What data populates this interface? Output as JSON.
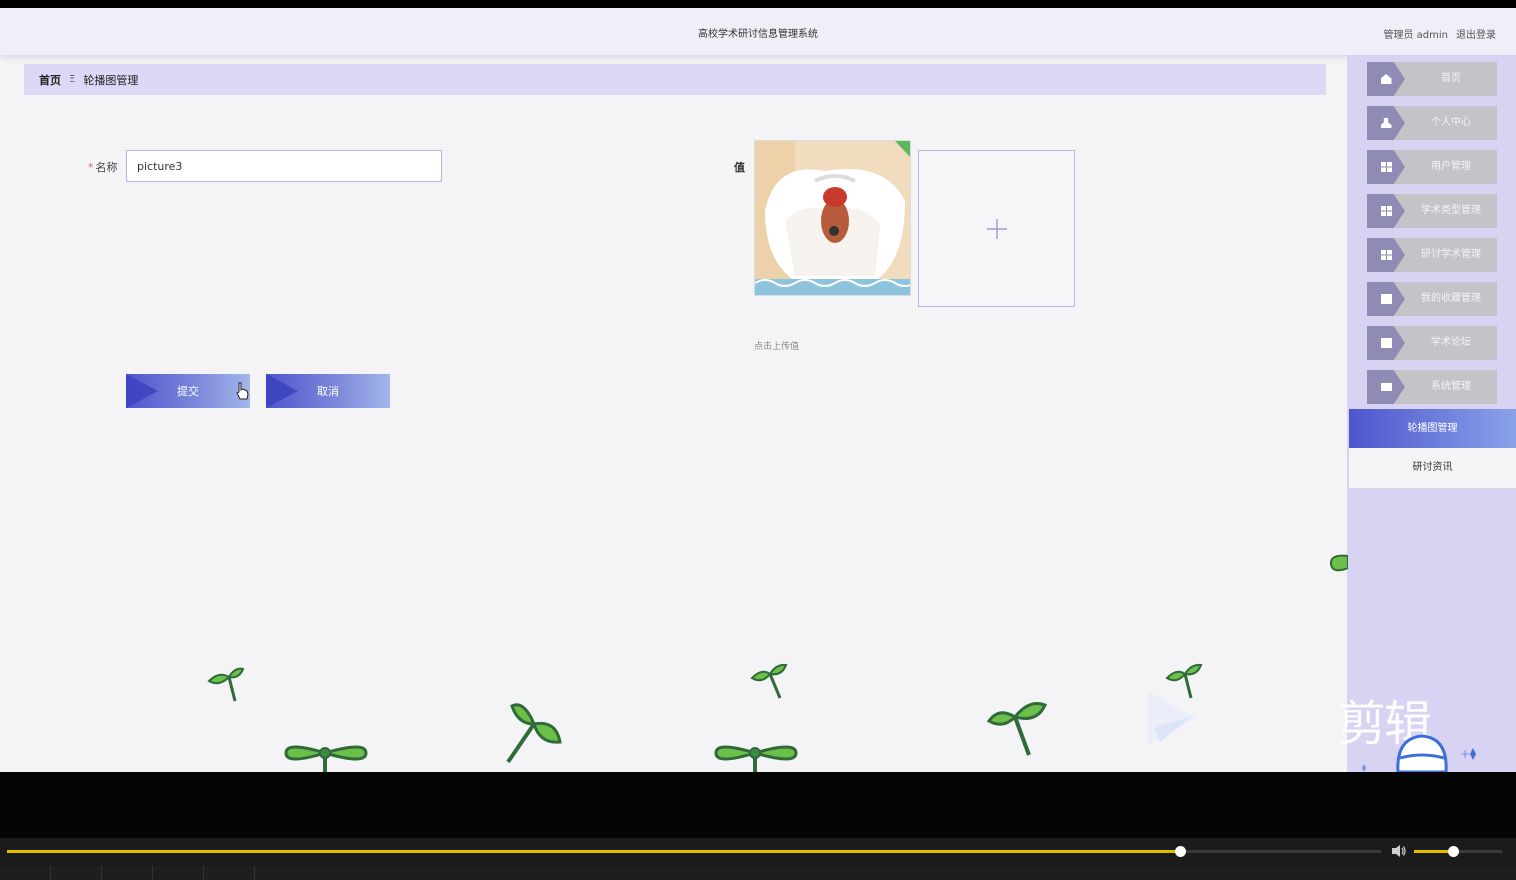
{
  "header": {
    "app_title": "高校学术研讨信息管理系统",
    "user_role": "管理员 admin",
    "logout": "退出登录"
  },
  "breadcrumb": {
    "home": "首页",
    "separator": "Ξ",
    "current": "轮播图管理"
  },
  "form": {
    "name_label": "名称",
    "name_value": "picture3",
    "value_label": "值",
    "upload_hint": "点击上传值",
    "upload_icon": "plus-icon",
    "submit": "提交",
    "cancel": "取消"
  },
  "sidebar": {
    "items": [
      {
        "label": "首页",
        "icon": "home-icon"
      },
      {
        "label": "个人中心",
        "icon": "user-icon"
      },
      {
        "label": "用户管理",
        "icon": "grid-icon"
      },
      {
        "label": "学术类型管理",
        "icon": "grid-icon"
      },
      {
        "label": "研讨学术管理",
        "icon": "grid-icon"
      },
      {
        "label": "我的收藏管理",
        "icon": "check-icon"
      },
      {
        "label": "学术论坛",
        "icon": "close-box-icon"
      },
      {
        "label": "系统管理",
        "icon": "ticket-icon"
      }
    ],
    "active_item": "轮播图管理",
    "sub_item": "研讨资讯"
  },
  "watermark": {
    "text": "剪辑"
  },
  "player": {
    "progress": 0.854,
    "volume": 0.44
  },
  "colors": {
    "accent": "#4e55cc",
    "sidebar_bg": "#d8d3f2",
    "breadcrumb_bg": "#dcd8f5",
    "progress": "#e2c000"
  }
}
